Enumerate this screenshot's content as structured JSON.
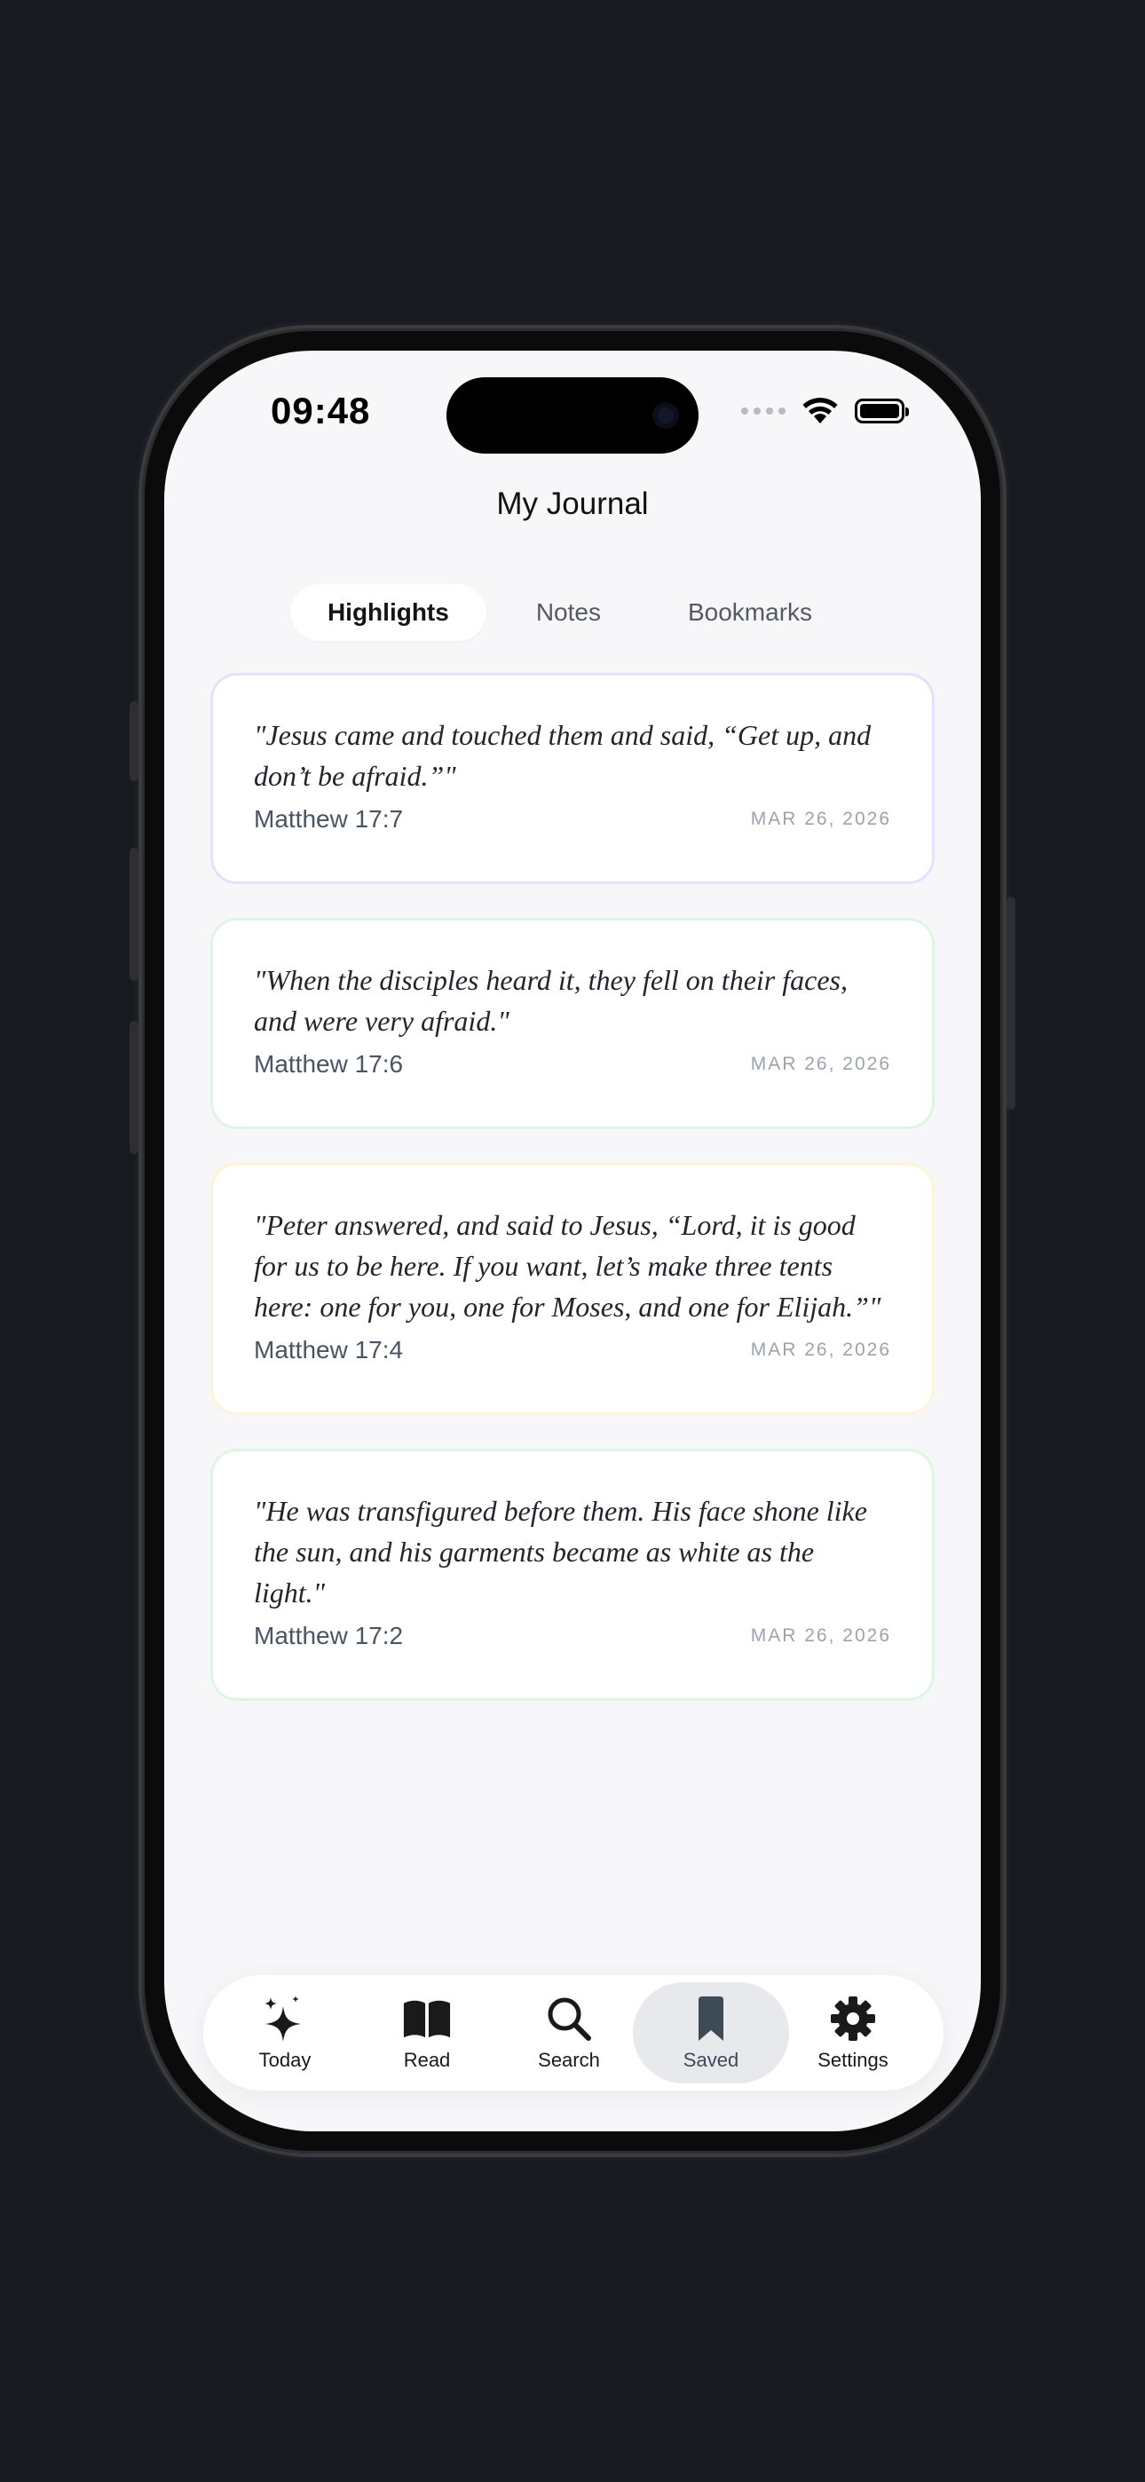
{
  "status_bar": {
    "time": "09:48"
  },
  "header": {
    "title": "My Journal"
  },
  "tabs": [
    {
      "label": "Highlights",
      "active": true
    },
    {
      "label": "Notes",
      "active": false
    },
    {
      "label": "Bookmarks",
      "active": false
    }
  ],
  "highlights": [
    {
      "quote": "\"Jesus came and touched them and said, “Get up, and don’t be afraid.”\"",
      "reference": "Matthew 17:7",
      "date": "MAR 26, 2026",
      "border_color": "#e8dffd"
    },
    {
      "quote": "\"When the disciples heard it, they fell on their faces, and were very afraid.\"",
      "reference": "Matthew 17:6",
      "date": "MAR 26, 2026",
      "border_color": "#dff5e3"
    },
    {
      "quote": "\"Peter answered, and said to Jesus, “Lord, it is good for us to be here. If you want, let’s make three tents here: one for you, one for Moses, and one for Elijah.”\"",
      "reference": "Matthew 17:4",
      "date": "MAR 26, 2026",
      "border_color": "#fdf4d8"
    },
    {
      "quote": "\"He was transfigured before them. His face shone like the sun, and his garments became as white as the light.\"",
      "reference": "Matthew 17:2",
      "date": "MAR 26, 2026",
      "border_color": "#dff5e3"
    }
  ],
  "tabbar": [
    {
      "label": "Today",
      "icon": "sparkles-icon",
      "active": false
    },
    {
      "label": "Read",
      "icon": "book-icon",
      "active": false
    },
    {
      "label": "Search",
      "icon": "search-icon",
      "active": false
    },
    {
      "label": "Saved",
      "icon": "bookmark-icon",
      "active": true
    },
    {
      "label": "Settings",
      "icon": "gear-icon",
      "active": false
    }
  ],
  "colors": {
    "background": "#171a21",
    "screen": "#f7f7f9",
    "accent": "#3f4a57"
  }
}
